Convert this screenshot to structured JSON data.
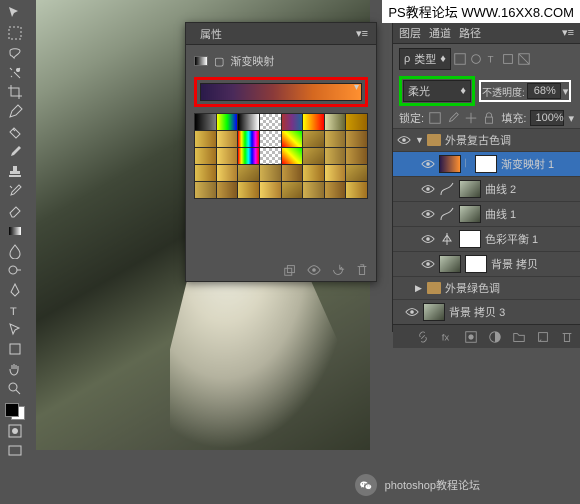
{
  "watermark": "PS教程论坛 WWW.16XX8.COM",
  "bottom": "photoshop教程论坛",
  "properties": {
    "tab": "属性",
    "title": "渐变映射"
  },
  "layers": {
    "tabs": [
      "图层",
      "通道",
      "路径"
    ],
    "type_label": "类型",
    "blend": "柔光",
    "opacity_label": "不透明度:",
    "opacity_value": "68%",
    "lock_label": "锁定:",
    "fill_label": "填充:",
    "fill_value": "100%",
    "group1": "外景复古色调",
    "items": {
      "gradmap": "渐变映射 1",
      "curve2": "曲线 2",
      "curve1": "曲线 1",
      "colorbal": "色彩平衡 1",
      "bgcopy": "背景 拷贝",
      "group2": "外景绿色调",
      "bgcopy3": "背景 拷贝 3"
    }
  }
}
